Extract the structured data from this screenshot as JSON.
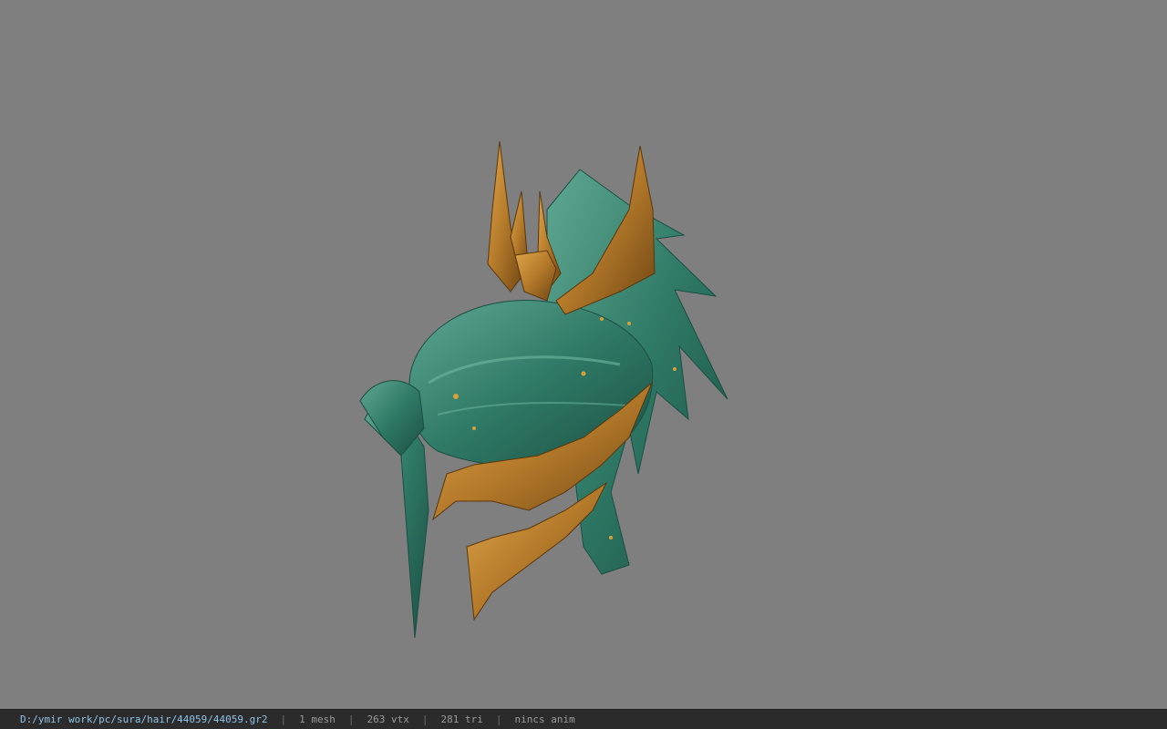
{
  "viewer": {
    "background_color": "#7f7f7f",
    "model_icon": "hair-helmet-model-icon",
    "model_colors": {
      "teal": "#2f7a66",
      "teal_dark": "#1c4f43",
      "teal_light": "#5fa893",
      "gold": "#b47a2a",
      "gold_dark": "#6e4513",
      "gold_light": "#e0a64a"
    }
  },
  "status": {
    "path": "D:/ymir work/pc/sura/hair/44059/44059.gr2",
    "separator": "|",
    "mesh": "1 mesh",
    "vtx": "263 vtx",
    "tri": "281 tri",
    "anim": "nincs anim"
  }
}
